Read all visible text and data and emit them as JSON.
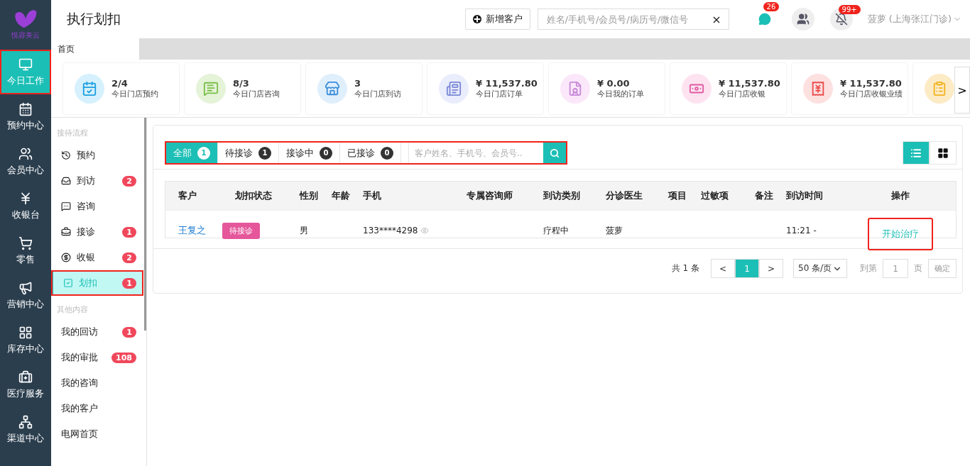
{
  "brand": {
    "logo_text": "悦容美云"
  },
  "nav": [
    {
      "label": "今日工作",
      "selected": true
    },
    {
      "label": "预约中心",
      "selected": false
    },
    {
      "label": "会员中心",
      "selected": false
    },
    {
      "label": "收银台",
      "selected": false
    },
    {
      "label": "零售",
      "selected": false
    },
    {
      "label": "营销中心",
      "selected": false
    },
    {
      "label": "库存中心",
      "selected": false
    },
    {
      "label": "医疗服务",
      "selected": false
    },
    {
      "label": "渠道中心",
      "selected": false
    }
  ],
  "header": {
    "title": "执行划扣",
    "add_button": "新增客户",
    "search": {
      "placeholder": "姓名/手机号/会员号/病历号/微信号",
      "clear": "×"
    },
    "wechat_badge": "26",
    "notice_badge": "99+",
    "user": "菠萝 (上海张江门诊)"
  },
  "page_tabs": [
    {
      "label": "首页",
      "selected": true
    }
  ],
  "stats": [
    {
      "value": "2/4",
      "label": "今日门店预约"
    },
    {
      "value": "8/3",
      "label": "今日门店咨询"
    },
    {
      "value": "3",
      "label": "今日门店到访"
    },
    {
      "value": "¥ 11,537.80",
      "label": "今日门店订单"
    },
    {
      "value": "¥ 0.00",
      "label": "今日我的订单"
    },
    {
      "value": "¥ 11,537.80",
      "label": "今日门店收银"
    },
    {
      "value": "¥ 11,537.80",
      "label": "今日门店收银业绩"
    }
  ],
  "stats_next": ">",
  "side_menu": [
    {
      "heading": "接待流程",
      "items": [
        {
          "label": "预约",
          "selected": false
        },
        {
          "label": "到访",
          "badge": "2",
          "selected": false
        },
        {
          "label": "咨询",
          "selected": false
        },
        {
          "label": "接诊",
          "badge": "1",
          "selected": false
        },
        {
          "label": "收银",
          "badge": "2",
          "selected": false
        },
        {
          "label": "划扣",
          "badge": "1",
          "selected": true
        }
      ]
    },
    {
      "heading": "其他内容",
      "items": [
        {
          "label": "我的回访",
          "badge": "1",
          "selected": false
        },
        {
          "label": "我的审批",
          "badge": "108",
          "selected": false
        },
        {
          "label": "我的咨询",
          "selected": false
        },
        {
          "label": "我的客户",
          "selected": false
        },
        {
          "label": "电网首页",
          "selected": false
        }
      ]
    }
  ],
  "filters": [
    {
      "label": "全部",
      "count": "1",
      "selected": true
    },
    {
      "label": "待接诊",
      "count": "1",
      "selected": false
    },
    {
      "label": "接诊中",
      "count": "0",
      "selected": false
    },
    {
      "label": "已接诊",
      "count": "0",
      "selected": false
    }
  ],
  "filter_search": {
    "placeholder": "客户姓名、手机号、会员号.."
  },
  "view_modes": [
    {
      "kind": "list",
      "selected": true
    },
    {
      "kind": "grid",
      "selected": false
    }
  ],
  "table": {
    "columns": [
      "客户",
      "划扣状态",
      "性别",
      "年龄",
      "手机",
      "专属咨询师",
      "到访类别",
      "分诊医生",
      "项目",
      "过敏项",
      "备注",
      "到访时间",
      "操作"
    ],
    "rows": [
      {
        "customer": "王复之",
        "status": "待接诊",
        "gender": "男",
        "phone": "133****4298",
        "visit_type": "疗程中",
        "doctor": "菠萝",
        "time": "11:21 -",
        "action": "开始治疗"
      }
    ]
  },
  "pagination": {
    "total": "共 1 条",
    "prev": "<",
    "pages": [
      {
        "label": "1",
        "selected": true
      }
    ],
    "next": ">",
    "page_size": "50 条/页",
    "goto_label": "到第",
    "goto_value": "1",
    "page_unit": "页",
    "confirm": "确定"
  }
}
